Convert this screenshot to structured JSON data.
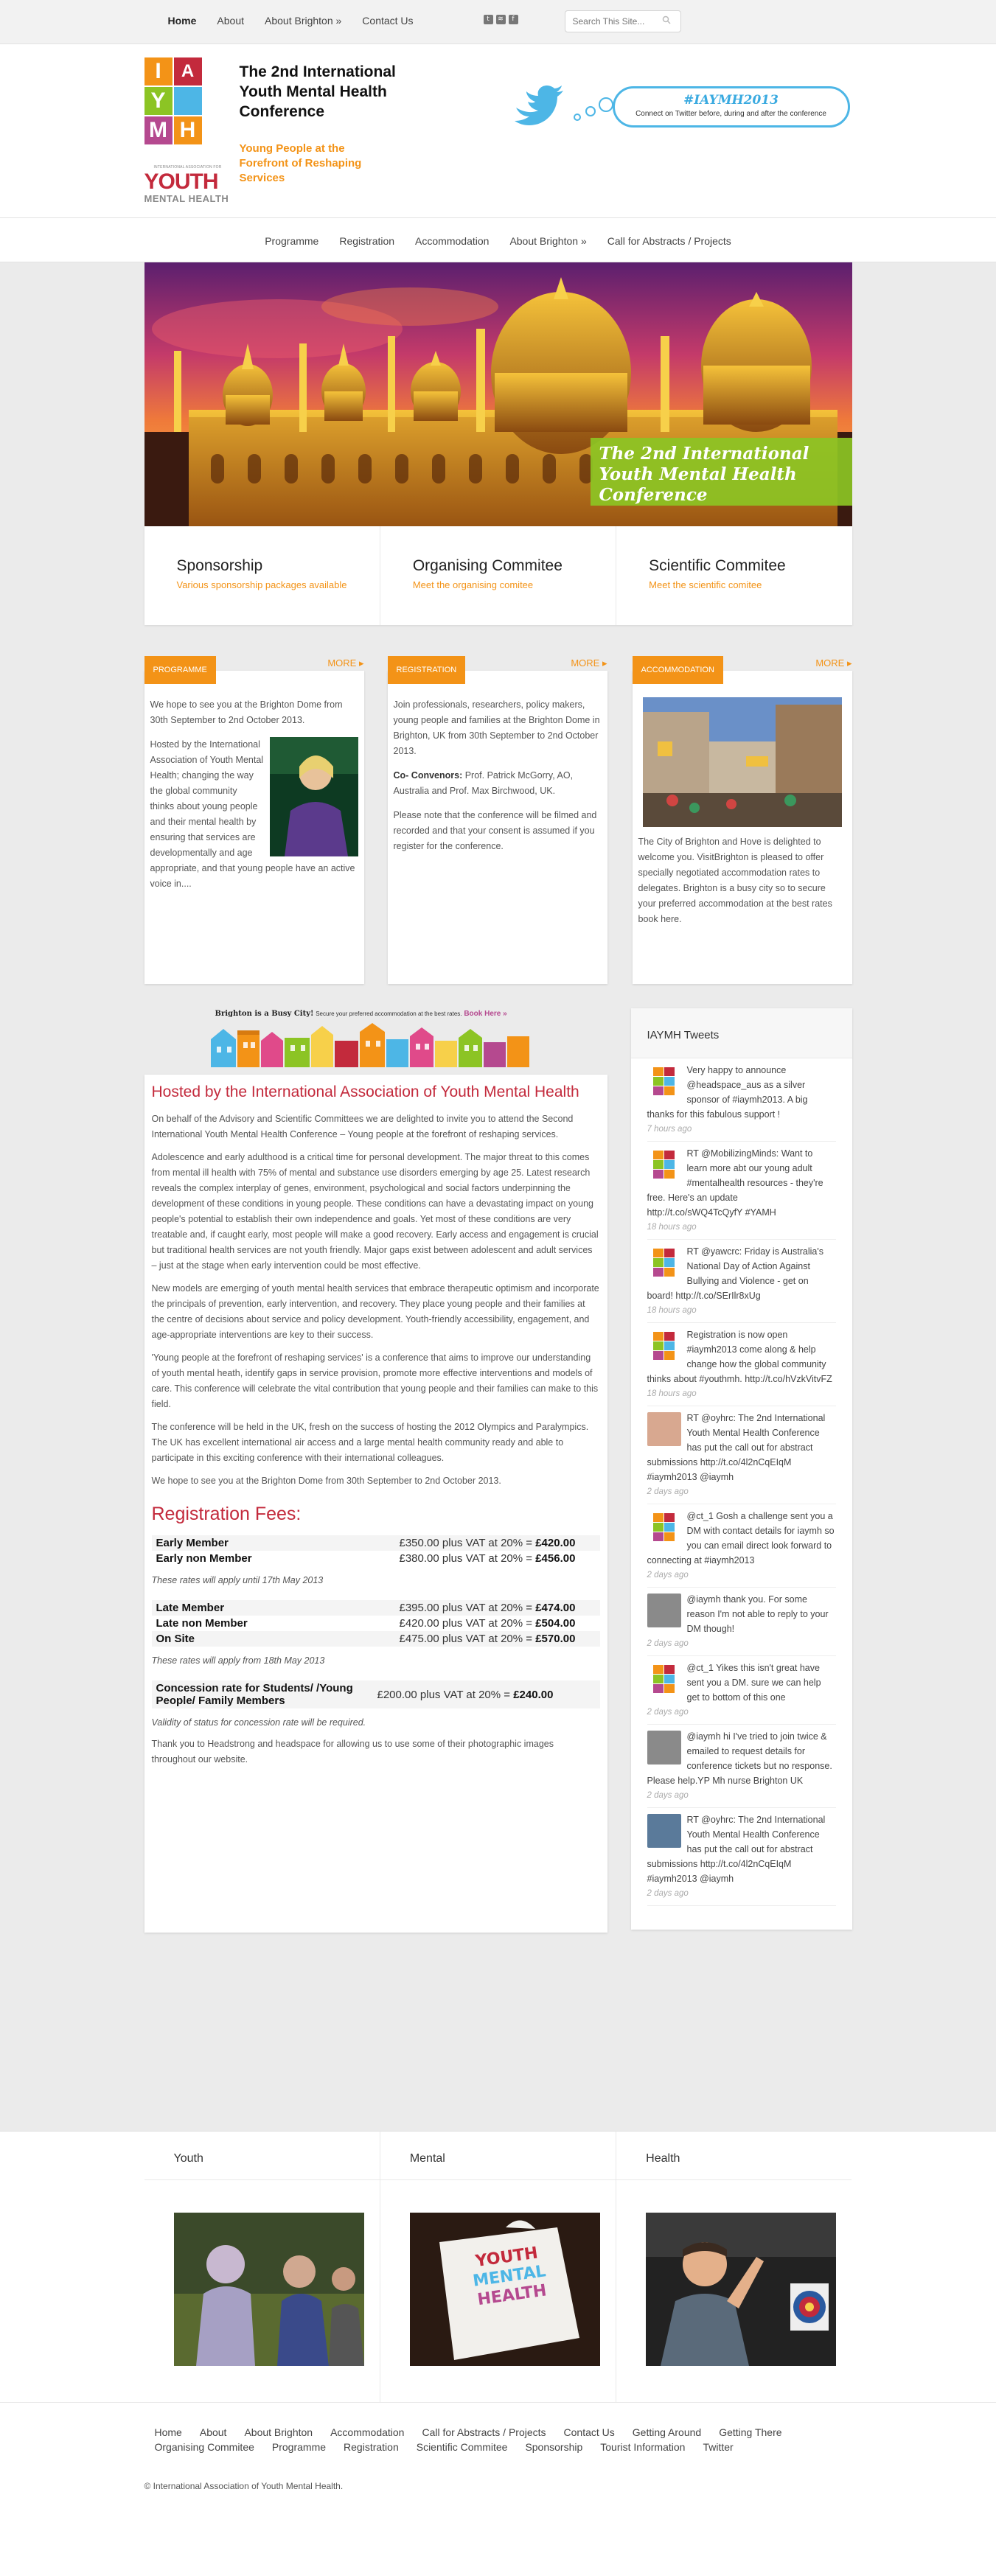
{
  "topnav": {
    "items": [
      "Home",
      "About",
      "About Brighton »",
      "Contact Us"
    ]
  },
  "search": {
    "placeholder": "Search This Site..."
  },
  "header": {
    "site_title": "The 2nd International Youth Mental Health Conference",
    "tagline": "Young People at the Forefront of Reshaping Services",
    "logo": {
      "assoc": "INTERNATIONAL ASSOCIATION FOR",
      "youth": "YOUTH",
      "mh": "MENTAL HEALTH"
    },
    "twitter_tag": "#IAYMH2013",
    "twitter_sub": "Connect on Twitter before, during and after the conference"
  },
  "mainnav": {
    "items": [
      "Programme",
      "Registration",
      "Accommodation",
      "About Brighton »",
      "Call for Abstracts / Projects"
    ]
  },
  "slider": {
    "caption": "The 2nd International Youth Mental Health Conference"
  },
  "topboxes": [
    {
      "title": "Sponsorship",
      "link": "Various sponsorship packages available"
    },
    {
      "title": "Organising Commitee",
      "link": "Meet the organising comitee"
    },
    {
      "title": "Scientific Commitee",
      "link": "Meet the scientific comitee"
    }
  ],
  "widgets": {
    "more": "MORE",
    "programme": {
      "tab": "PROGRAMME",
      "p1": "We hope to see you at the Brighton Dome from 30th September to 2nd October 2013.",
      "p2": "Hosted by the International Association of Youth Mental Health; changing the way the global community thinks about young people and their mental health by ensuring that services are developmentally and age appropriate, and that young people have an active voice in...."
    },
    "registration": {
      "tab": "REGISTRATION",
      "p1": "Join professionals, researchers, policy makers, young people and families at the Brighton Dome in Brighton, UK from 30th September to 2nd October 2013.",
      "convenors_label": "Co- Convenors:",
      "convenors": " Prof. Patrick McGorry, AO, Australia and Prof. Max Birchwood, UK.",
      "p3": "Please note that the conference will be filmed and recorded and that your consent is assumed if you register for the conference."
    },
    "accommodation": {
      "tab": "ACCOMMODATION",
      "p1": "The City of Brighton and Hove is delighted to welcome you. VisitBrighton is pleased to offer specially negotiated accommodation rates to delegates. Brighton is a busy city so to secure your preferred accommodation at the best rates book here."
    }
  },
  "banner": {
    "title": "Brighton is a Busy City!",
    "text": "Secure your preferred accommodation at the best rates.",
    "link": "Book Here »"
  },
  "article": {
    "heading": "Hosted by the International Association of Youth Mental Health",
    "paragraphs": [
      "On behalf of the Advisory and Scientific Committees we are delighted to invite you to attend the Second International Youth Mental Health Conference – Young people at the forefront of reshaping services.",
      "Adolescence and early adulthood is a critical time for personal development. The major threat to this comes from mental ill health with 75% of mental and substance use disorders emerging by age 25. Latest research reveals the complex interplay of genes, environment, psychological and social factors underpinning the development of these conditions in young people. These conditions can have a devastating impact on young people's potential to establish their own independence and goals. Yet most of these conditions are very treatable and, if caught early, most people will make a good recovery. Early access and engagement is crucial but traditional health services are not youth friendly. Major gaps exist between adolescent and adult services – just at the stage when early intervention could be most effective.",
      "New models are emerging of youth mental health services that embrace therapeutic optimism and incorporate the principals of prevention, early intervention, and recovery. They place young people and their families at the centre of decisions about service and policy development. Youth-friendly accessibility, engagement, and age-appropriate interventions are key to their success.",
      "'Young people at the forefront of reshaping services' is a conference that aims to improve our understanding of youth mental heath, identify gaps in service provision, promote more effective interventions and models of care. This conference will celebrate the vital contribution that young people and their families can make to this field.",
      "The conference will be held in the UK, fresh on the success of hosting the 2012 Olympics and Paralympics. The UK has excellent international air access and a large mental health community ready and able to participate in this exciting conference with their international colleagues.",
      "We hope to see you at the Brighton Dome from 30th September to 2nd October 2013."
    ],
    "fees_heading": "Registration Fees:",
    "fees_early": [
      {
        "label": "Early Member",
        "price": "£350.00 plus VAT at 20% = ",
        "total": "£420.00"
      },
      {
        "label": "Early non Member",
        "price": "£380.00 plus VAT at 20% = ",
        "total": "£456.00"
      }
    ],
    "note_early": "These rates will apply until 17th May 2013",
    "fees_late": [
      {
        "label": "Late Member",
        "price": "£395.00 plus VAT at 20% = ",
        "total": "£474.00"
      },
      {
        "label": "Late non Member",
        "price": "£420.00 plus VAT at 20% = ",
        "total": "£504.00"
      },
      {
        "label": "On Site",
        "price": "£475.00 plus VAT at 20% = ",
        "total": "£570.00"
      }
    ],
    "note_late": "These rates will apply from 18th May 2013",
    "fees_concession": [
      {
        "label": "Concession rate for Students/ /Young People/ Family Members",
        "price": "£200.00 plus VAT at 20% = ",
        "total": "£240.00"
      }
    ],
    "note_concession": "Validity of status for concession rate will be required.",
    "thanks": "Thank you to Headstrong and headspace for allowing us to use some of their photographic images throughout our website."
  },
  "tweets": {
    "title": "IAYMH Tweets",
    "items": [
      {
        "text": "Very happy to announce @headspace_aus as a silver sponsor of #iaymh2013. A big thanks for this fabulous support !",
        "time": "7 hours ago"
      },
      {
        "text": "RT @MobilizingMinds: Want to learn more abt our young adult #mentalhealth resources - they're free. Here's an update http://t.co/sWQ4TcQyfY #YAMH",
        "time": "18 hours ago"
      },
      {
        "text": "RT @yawcrc: Friday is Australia's National Day of Action Against Bullying and Violence - get on board! http://t.co/SErIlr8xUg",
        "time": "18 hours ago"
      },
      {
        "text": "Registration is now open #iaymh2013 come along & help change how the global community thinks about #youthmh. http://t.co/hVzkVitvFZ",
        "time": "18 hours ago"
      },
      {
        "text": "RT @oyhrc: The 2nd International Youth Mental Health Conference has put the call out for abstract submissions http://t.co/4l2nCqEIqM #iaymh2013 @iaymh",
        "time": "2 days ago"
      },
      {
        "text": "@ct_1 Gosh a challenge sent you a DM with contact details for iaymh so you can email direct look forward to connecting at #iaymh2013",
        "time": "2 days ago"
      },
      {
        "text": "@iaymh thank you. For some reason I'm not able to reply to your DM though!",
        "time": "2 days ago"
      },
      {
        "text": "@ct_1 Yikes this isn't great have sent you a DM. sure we can help get to bottom of this one",
        "time": "2 days ago"
      },
      {
        "text": "@iaymh hi I've tried to join twice & emailed to request details for conference tickets but no response. Please help.YP Mh nurse Brighton UK",
        "time": "2 days ago"
      },
      {
        "text": "RT @oyhrc: The 2nd International Youth Mental Health Conference has put the call out for abstract submissions http://t.co/4l2nCqEIqM #iaymh2013 @iaymh",
        "time": "2 days ago"
      }
    ]
  },
  "bottom": {
    "cols": [
      "Youth",
      "Mental",
      "Health"
    ],
    "puzzle": [
      "YOUTH",
      "MENTAL",
      "HEALTH"
    ]
  },
  "footer": {
    "nav": [
      "Home",
      "About",
      "About Brighton",
      "Accommodation",
      "Call for Abstracts / Projects",
      "Contact Us",
      "Getting Around",
      "Getting There",
      "Organising Commitee",
      "Programme",
      "Registration",
      "Scientific Commitee",
      "Sponsorship",
      "Tourist Information",
      "Twitter"
    ],
    "copyright": "© International Association of Youth Mental Health."
  },
  "colors": {
    "orange": "#f39317",
    "crimson": "#c32a3c",
    "green": "#8cc424",
    "twitter": "#4db6e6"
  }
}
